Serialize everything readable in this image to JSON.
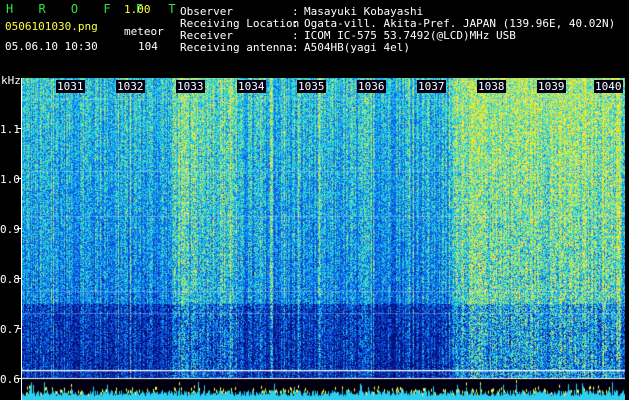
{
  "header": {
    "app_title": "H R O F F T",
    "app_version": "1.00",
    "file_name": "0506101030.png",
    "datetime": "05.06.10 10:30",
    "mode_label": "meteor",
    "mode_count": "104"
  },
  "info": [
    {
      "key": "Observer",
      "value": "Masayuki Kobayashi"
    },
    {
      "key": "Receiving Location",
      "value": "Ogata-vill. Akita-Pref. JAPAN (139.96E, 40.02N)"
    },
    {
      "key": "Receiver",
      "value": "ICOM IC-575 53.7492(@LCD)MHz USB"
    },
    {
      "key": "Receiving antenna",
      "value": "A504HB(yagi 4el)"
    }
  ],
  "info_separator": ":",
  "spectrogram": {
    "y_unit": "kHz",
    "y_ticks": [
      "1.1",
      "1.0",
      "0.9",
      "0.8",
      "0.7",
      "0.6"
    ],
    "x_ticks": [
      "1031",
      "1032",
      "1033",
      "1034",
      "1035",
      "1036",
      "1037",
      "1038",
      "1039",
      "1040"
    ],
    "colors": {
      "background": "#000010",
      "low": "#0a1a8c",
      "mid": "#1e64ff",
      "high": "#34e0c8",
      "peak": "#ffff40",
      "baseline": "#2ecff0"
    }
  }
}
